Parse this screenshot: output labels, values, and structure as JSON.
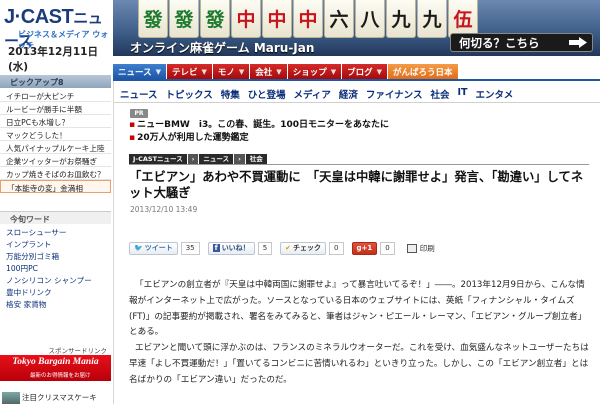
{
  "header": {
    "logo_j": "J",
    "logo_cast": "·CAST",
    "logo_news": "ニュース",
    "logo_sub": "ビジネス＆メディア ウォッチ",
    "date": "2013年12月11日(水)"
  },
  "banner": {
    "tiles": [
      {
        "char": "發",
        "color": "green"
      },
      {
        "char": "發",
        "color": "green"
      },
      {
        "char": "發",
        "color": "green"
      },
      {
        "char": "中",
        "color": "red"
      },
      {
        "char": "中",
        "color": "red"
      },
      {
        "char": "中",
        "color": "red"
      },
      {
        "char": "六",
        "color": "dark"
      },
      {
        "char": "八",
        "color": "dark"
      },
      {
        "char": "九",
        "color": "dark"
      },
      {
        "char": "九",
        "color": "dark"
      },
      {
        "char": "伍",
        "color": "red"
      }
    ],
    "title": "オンライン麻雀ゲーム Maru-Jan",
    "cta": "何切る？こちら"
  },
  "topnav": {
    "items": [
      {
        "label": "ニュース",
        "active": true
      },
      {
        "label": "テレビ"
      },
      {
        "label": "モノ"
      },
      {
        "label": "会社"
      },
      {
        "label": "ショップ"
      },
      {
        "label": "ブログ"
      },
      {
        "label": "がんばろう日本",
        "last": true
      }
    ]
  },
  "sidebar": {
    "pickup_header": "ピックアップ8",
    "pickup_items": [
      {
        "text": "イチローが大ピンチ"
      },
      {
        "text": "ルービーが勝手に半額"
      },
      {
        "text": "日立PCも水増し？"
      },
      {
        "text": "マックどうした！"
      },
      {
        "text": "人気パイナップルケーキ上陸"
      },
      {
        "text": "企業ツイッターがお祭騒ぎ"
      },
      {
        "text": "カップ焼きそばのお皿飲む？"
      },
      {
        "text": "「本能寺の変」金満相",
        "boxed": true
      }
    ],
    "words_header": "今旬ワード",
    "words": [
      "スローシューサー",
      "インプラント",
      "万能分別ゴミ箱",
      "100円PC",
      "ノンシリコン シャンプー",
      "豊中ドリンク",
      "格安 家賃物"
    ],
    "sponsor_label": "スポンサードリンク",
    "promo_title": "Tokyo Bargain Mania",
    "promo_sub": "最新のお得情報をお届け",
    "promo_item": "注目クリスマスケーキ"
  },
  "subnav": {
    "items": [
      "ニュース",
      "トピックス",
      "特集",
      "ひと登場",
      "メディア",
      "経済",
      "ファイナンス",
      "社会",
      "IT",
      "エンタメ"
    ]
  },
  "pr": {
    "badge": "PR",
    "lines": [
      "ニューBMW　i3。この春、誕生。100日モニターをあなたに",
      "20万人が利用した運勢鑑定"
    ]
  },
  "breadcrumb": {
    "items": [
      "J-CASTニュース",
      "ニュース",
      "社会"
    ]
  },
  "article": {
    "title": "「エビアン」あわや不買運動に　「天皇は中韓に謝罪せよ」発言、「勘違い」してネット大騒ぎ",
    "date": "2013/12/10 13:49",
    "paragraphs": [
      "「エビアンの創立者が『天皇は中韓両国に謝罪せよ』って暴言吐いてるぞ！」――。2013年12月9日から、こんな情報がインターネット上で広がった。ソースとなっている日本のウェブサイトには、英紙「フィナンシャル・タイムズ(FT)」の記事要約が掲載され、署名をみてみると、筆者はジャン・ピエール・レーマン、「エビアン・グループ創立者」とある。",
      "エビアンと聞いて頭に浮かぶのは、フランスのミネラルウオーターだ。これを受け、血気盛んなネットユーザーたちは早速「よし不買運動だ！」「置いてるコンビニに苦情いれるわ」といきり立った。しかし、この「エビアン創立者」とは名ばかりの「エビアン違い」だったのだ。"
    ]
  },
  "share": {
    "tweet_label": "ツイート",
    "tweet_count": "35",
    "like_label": "いいね！",
    "like_count": "5",
    "check_label": "チェック",
    "check_count": "0",
    "plus_label": "g+1",
    "plus_count": "0",
    "print_label": "印刷"
  },
  "colors": {
    "nav_red": "#c01414",
    "nav_blue": "#1d57a6",
    "nav_orange": "#e8781e",
    "link_blue": "#0b2e7a"
  }
}
